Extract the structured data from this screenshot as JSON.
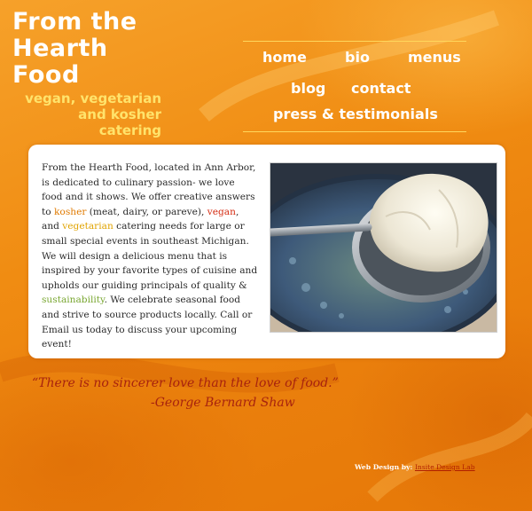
{
  "logo": {
    "title_line1": "From the",
    "title_line2": "Hearth Food",
    "tagline_line1": "vegan, vegetarian",
    "tagline_line2": "and kosher",
    "tagline_line3": "catering"
  },
  "nav": {
    "home": "home",
    "bio": "bio",
    "menus": "menus",
    "blog": "blog",
    "contact": "contact",
    "press": "press & testimonials"
  },
  "content": {
    "p1": "From the Hearth Food, located in Ann Arbor, is dedicated to culinary passion- we love food and it shows. We offer creative answers to ",
    "kosher": "kosher",
    "p2": " (meat, dairy, or pareve), ",
    "vegan": "vegan",
    "p3": ", and ",
    "vegetarian": "vegetarian",
    "p4": " catering needs for large or small special events in southeast Michigan. We will design a delicious menu that is inspired by your favorite types of cuisine and upholds our guiding principals of quality & ",
    "sustainability": "sustainability",
    "p5": ". We celebrate seasonal food and strive to source products locally. Call or Email us today to discuss your upcoming event!"
  },
  "quote": {
    "text": "“There is no sincerer love than the love of food.”",
    "author": "-George Bernard Shaw"
  },
  "footer": {
    "credit_label": "Web Design by:",
    "credit_link": "Insite Design Lab"
  },
  "colors": {
    "background": "#f08c12",
    "logo_tagline": "#ffe36b",
    "quote": "#a8230e",
    "kosher": "#e07a00",
    "vegan": "#d42a10",
    "vegetarian": "#e0a300",
    "sustainability": "#78a630"
  }
}
